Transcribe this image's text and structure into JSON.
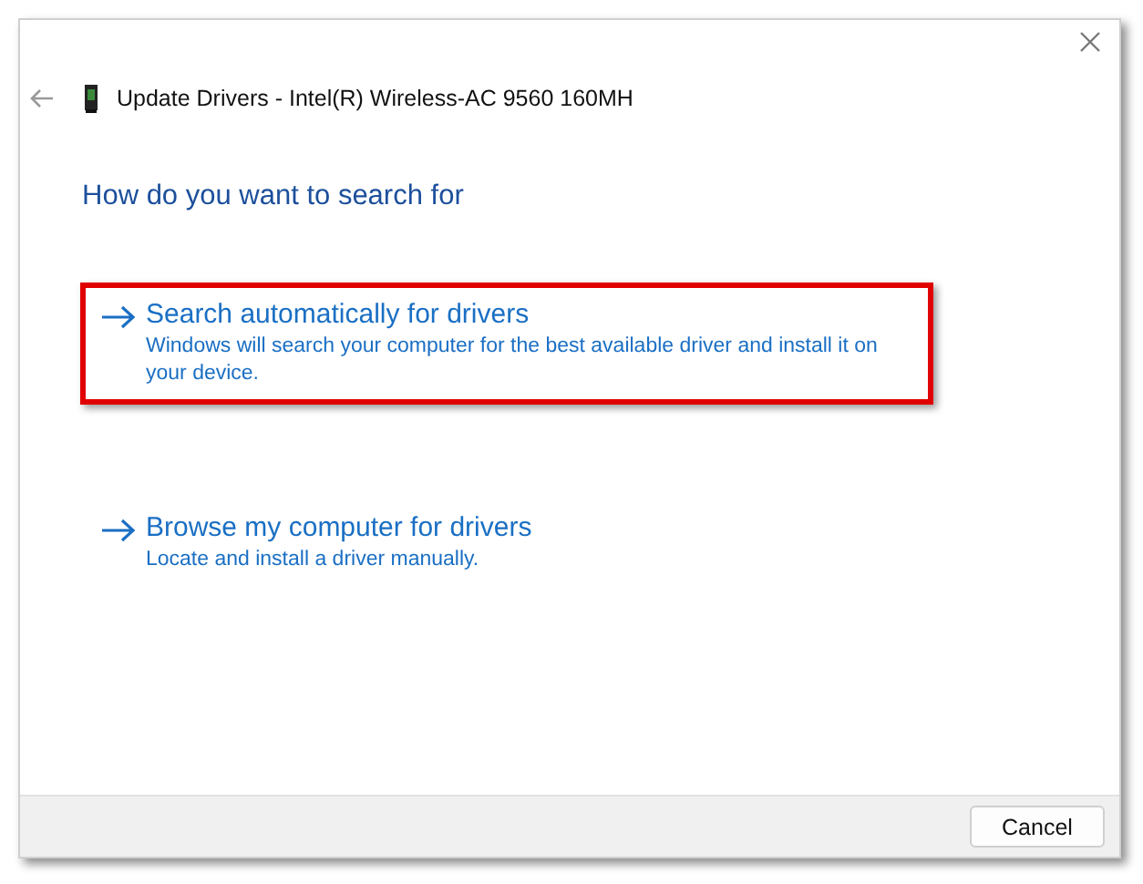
{
  "window": {
    "title": "Update Drivers - Intel(R) Wireless-AC 9560 160MH"
  },
  "heading": "How do you want to search for",
  "options": [
    {
      "title": "Search automatically for drivers",
      "description": "Windows will search your computer for the best available driver and install it on your device.",
      "highlighted": true
    },
    {
      "title": "Browse my computer for drivers",
      "description": "Locate and install a driver manually.",
      "highlighted": false
    }
  ],
  "buttons": [
    "Cancel"
  ]
}
